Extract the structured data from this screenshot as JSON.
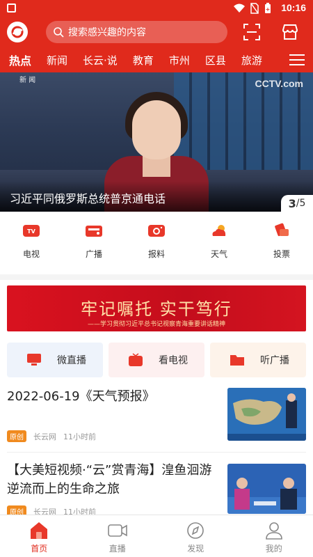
{
  "status_bar": {
    "time": "10:16",
    "icons": [
      "image-icon",
      "wifi-icon",
      "no-sim-icon",
      "battery-icon"
    ]
  },
  "header": {
    "search_placeholder": "搜索感兴趣的内容",
    "icons": [
      "app-logo",
      "scan-icon",
      "store-icon"
    ]
  },
  "nav_tabs": [
    "热点",
    "新闻",
    "长云·说",
    "教育",
    "市州",
    "区县",
    "旅游"
  ],
  "banner": {
    "caption": "习近平同俄罗斯总统普京通电话",
    "current": "3",
    "total": "/5",
    "watermark": "CCTV.com",
    "corner_text": "新 闻"
  },
  "quick_links": [
    {
      "label": "电视",
      "icon": "tv-icon"
    },
    {
      "label": "广播",
      "icon": "radio-icon"
    },
    {
      "label": "报料",
      "icon": "camera-icon"
    },
    {
      "label": "天气",
      "icon": "weather-icon"
    },
    {
      "label": "投票",
      "icon": "vote-icon"
    }
  ],
  "slogan": {
    "main": "牢记嘱托 实干笃行",
    "sub": "——学习贯彻习近平总书记视察青海重要讲话精神"
  },
  "media_cards": [
    {
      "label": "微直播",
      "icon": "monitor-icon",
      "bg": "#eef3fb"
    },
    {
      "label": "看电视",
      "icon": "tv-icon",
      "bg": "#fdf0f0"
    },
    {
      "label": "听广播",
      "icon": "folder-radio-icon",
      "bg": "#fdf3ea"
    }
  ],
  "articles": [
    {
      "title": "2022-06-19《天气预报》",
      "tag": "原创",
      "source": "长云网",
      "time": "11小时前"
    },
    {
      "title": "【大美短视频·“云”赏青海】湟鱼洄游逆流而上的生命之旅",
      "tag": "原创",
      "source": "长云网",
      "time": "11小时前"
    }
  ],
  "bottom_nav": [
    {
      "label": "首页",
      "icon": "home-icon",
      "active": true
    },
    {
      "label": "直播",
      "icon": "video-icon",
      "active": false
    },
    {
      "label": "发现",
      "icon": "compass-icon",
      "active": false
    },
    {
      "label": "我的",
      "icon": "user-icon",
      "active": false
    }
  ],
  "colors": {
    "brand": "#e02a1c",
    "accent": "#e8382a",
    "tag": "#f08a1e"
  }
}
